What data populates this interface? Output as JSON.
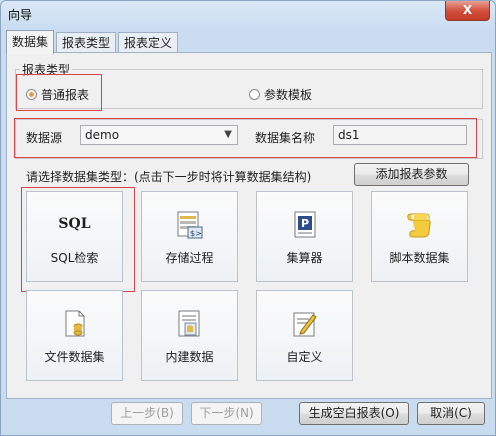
{
  "window": {
    "title": "向导",
    "close_label": "X"
  },
  "tabs": [
    {
      "label": "数据集"
    },
    {
      "label": "报表类型"
    },
    {
      "label": "报表定义"
    }
  ],
  "report_type": {
    "legend": "报表类型",
    "options": [
      {
        "label": "普通报表",
        "selected": true
      },
      {
        "label": "参数模板",
        "selected": false
      }
    ]
  },
  "datasource": {
    "label": "数据源",
    "value": "demo",
    "name_label": "数据集名称",
    "name_value": "ds1"
  },
  "dataset_hint": "请选择数据集类型：(点击下一步时将计算数据集结构)",
  "add_param_button": "添加报表参数",
  "dataset_types": [
    {
      "label": "SQL检索",
      "icon": "sql-icon",
      "icon_text": "SQL"
    },
    {
      "label": "存储过程",
      "icon": "stored-procedure-icon"
    },
    {
      "label": "集算器",
      "icon": "esproc-icon"
    },
    {
      "label": "脚本数据集",
      "icon": "script-scroll-icon"
    },
    {
      "label": "文件数据集",
      "icon": "file-icon"
    },
    {
      "label": "内建数据",
      "icon": "builtin-data-icon"
    },
    {
      "label": "自定义",
      "icon": "custom-edit-icon"
    }
  ],
  "footer": {
    "prev": "上一步(B)",
    "next": "下一步(N)",
    "blank": "生成空白报表(O)",
    "cancel": "取消(C)"
  }
}
